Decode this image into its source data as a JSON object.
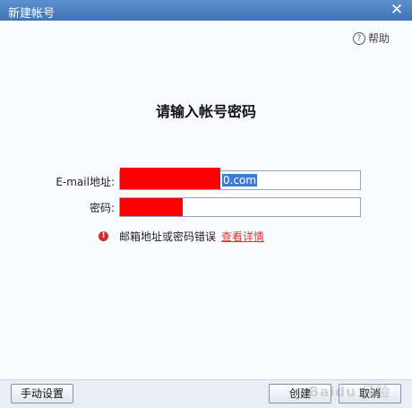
{
  "window": {
    "title": "新建帐号"
  },
  "help": {
    "label": "帮助"
  },
  "form": {
    "heading": "请输入帐号密码",
    "email_label": "E-mail地址:",
    "email_visible_suffix": "0.com",
    "password_label": "密码:"
  },
  "error": {
    "message": "邮箱地址或密码错误",
    "link": "查看详情",
    "icon_color": "#c9302c"
  },
  "footer": {
    "manual_button": "手动设置",
    "create_button": "创建",
    "cancel_button": "取消"
  },
  "colors": {
    "titlebar": "#4a7fc0",
    "redaction": "#ff0000",
    "selection": "#3a7bd5"
  },
  "watermark": "Baidu 经验"
}
